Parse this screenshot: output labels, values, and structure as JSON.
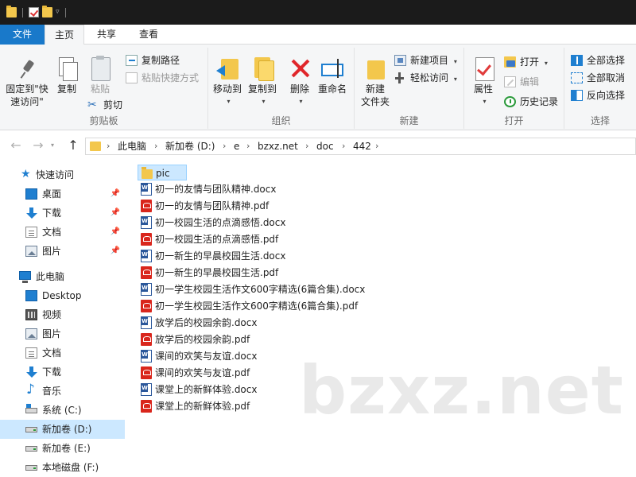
{
  "ribbon_tabs": {
    "file": "文件",
    "home": "主页",
    "share": "共享",
    "view": "查看"
  },
  "clipboard": {
    "pin_label_line1": "固定到\"快",
    "pin_label_line2": "速访问\"",
    "copy": "复制",
    "paste": "粘贴",
    "copy_path": "复制路径",
    "paste_shortcut": "粘贴快捷方式",
    "cut": "剪切",
    "group": "剪贴板"
  },
  "organize": {
    "move_to": "移动到",
    "copy_to": "复制到",
    "delete": "删除",
    "rename": "重命名",
    "group": "组织"
  },
  "new": {
    "new_folder_line1": "新建",
    "new_folder_line2": "文件夹",
    "new_item": "新建项目",
    "easy_access": "轻松访问",
    "group": "新建"
  },
  "open": {
    "properties": "属性",
    "open": "打开",
    "edit": "编辑",
    "history": "历史记录",
    "group": "打开"
  },
  "select": {
    "select_all": "全部选择",
    "select_none": "全部取消",
    "invert": "反向选择",
    "group": "选择"
  },
  "breadcrumb": [
    "此电脑",
    "新加卷 (D:)",
    "e",
    "bzxz.net",
    "doc",
    "442"
  ],
  "nav_pane": {
    "quick_access": "快速访问",
    "quick_items": [
      "桌面",
      "下载",
      "文档",
      "图片"
    ],
    "this_pc": "此电脑",
    "pc_items": [
      "Desktop",
      "视频",
      "图片",
      "文档",
      "下载",
      "音乐"
    ],
    "drives": [
      "系统 (C:)",
      "新加卷 (D:)",
      "新加卷 (E:)",
      "本地磁盘 (F:)"
    ],
    "selected_drive": "新加卷 (D:)"
  },
  "files": [
    {
      "name": "pic",
      "type": "folder"
    },
    {
      "name": "初一的友情与团队精神.docx",
      "type": "docx"
    },
    {
      "name": "初一的友情与团队精神.pdf",
      "type": "pdf"
    },
    {
      "name": "初一校园生活的点滴感悟.docx",
      "type": "docx"
    },
    {
      "name": "初一校园生活的点滴感悟.pdf",
      "type": "pdf"
    },
    {
      "name": "初一新生的早晨校园生活.docx",
      "type": "docx"
    },
    {
      "name": "初一新生的早晨校园生活.pdf",
      "type": "pdf"
    },
    {
      "name": "初一学生校园生活作文600字精选(6篇合集).docx",
      "type": "docx"
    },
    {
      "name": "初一学生校园生活作文600字精选(6篇合集).pdf",
      "type": "pdf"
    },
    {
      "name": "放学后的校园余韵.docx",
      "type": "docx"
    },
    {
      "name": "放学后的校园余韵.pdf",
      "type": "pdf"
    },
    {
      "name": "课间的欢笑与友谊.docx",
      "type": "docx"
    },
    {
      "name": "课间的欢笑与友谊.pdf",
      "type": "pdf"
    },
    {
      "name": "课堂上的新鲜体验.docx",
      "type": "docx"
    },
    {
      "name": "课堂上的新鲜体验.pdf",
      "type": "pdf"
    }
  ],
  "watermark": "bzxz.net",
  "colors": {
    "accent": "#1979ca",
    "selection": "#cce8ff",
    "folder": "#f3c74c",
    "pdf": "#d9261c",
    "word": "#2b579a"
  }
}
